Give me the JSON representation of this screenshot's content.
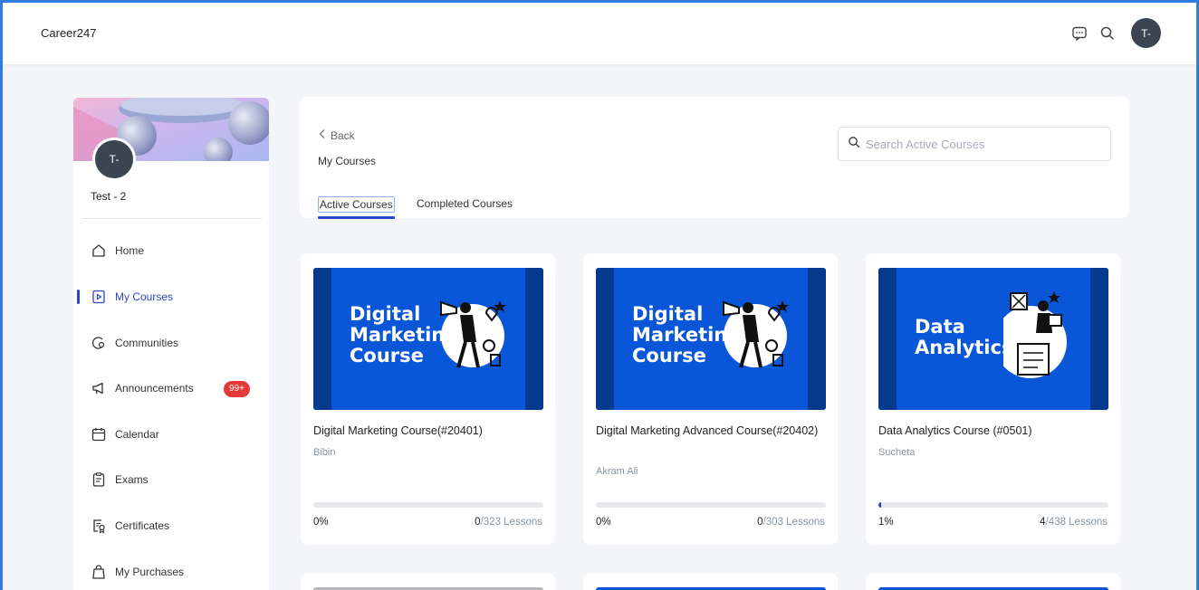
{
  "app": {
    "brand": "Career247",
    "user_initials": "T-"
  },
  "topbar": {
    "icons": [
      "chat-icon",
      "search-icon"
    ]
  },
  "sidebar": {
    "profile_name": "Test - 2",
    "items": [
      {
        "label": "Home",
        "icon": "home-icon"
      },
      {
        "label": "My Courses",
        "icon": "play-square-icon",
        "active": true
      },
      {
        "label": "Communities",
        "icon": "communities-icon"
      },
      {
        "label": "Announcements",
        "icon": "megaphone-icon",
        "badge": "99+"
      },
      {
        "label": "Calendar",
        "icon": "calendar-icon"
      },
      {
        "label": "Exams",
        "icon": "exam-icon"
      },
      {
        "label": "Certificates",
        "icon": "certificate-icon"
      },
      {
        "label": "My Purchases",
        "icon": "shopping-bag-icon"
      }
    ]
  },
  "header": {
    "back_label": "Back",
    "title": "My Courses",
    "search_placeholder": "Search Active Courses",
    "tabs": [
      {
        "label": "Active Courses",
        "active": true
      },
      {
        "label": "Completed Courses",
        "active": false
      }
    ]
  },
  "courses": [
    {
      "thumb_text": "Digital\nMarketing\nCourse",
      "title": "Digital Marketing Course(#20401)",
      "instructor": "Bibin",
      "progress_label": "0%",
      "progress": 0,
      "completed": "0",
      "total": "/323 Lessons"
    },
    {
      "thumb_text": "Digital\nMarketing\nCourse",
      "title": "Digital Marketing Advanced Course(#20402)",
      "instructor": "Akram Ali",
      "progress_label": "0%",
      "progress": 0,
      "completed": "0",
      "total": "/303 Lessons"
    },
    {
      "thumb_text": "Data\nAnalytics",
      "title": "Data Analytics Course (#0501)",
      "instructor": "Sucheta",
      "progress_label": "1%",
      "progress": 0.01,
      "completed": "4",
      "total": "/438 Lessons"
    }
  ],
  "colors": {
    "accent": "#2a47c7",
    "badge": "#e53935",
    "thumb": "#0a56d8"
  }
}
